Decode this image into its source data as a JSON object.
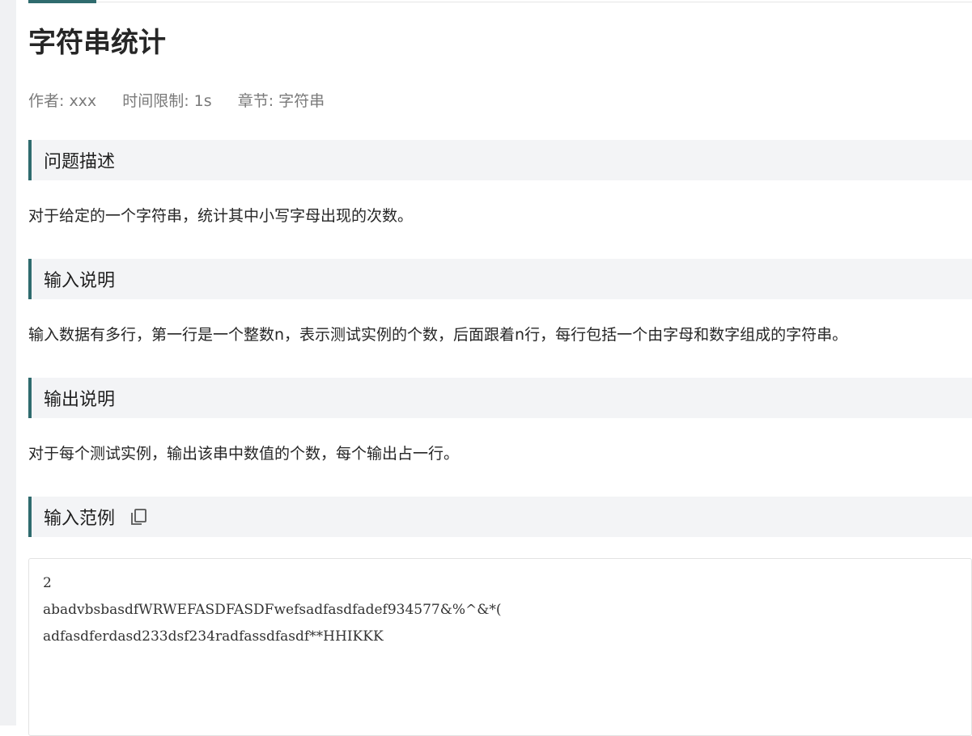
{
  "problem": {
    "title": "字符串统计",
    "meta": {
      "author": "作者: xxx",
      "time_limit": "时间限制: 1s",
      "chapter": "章节: 字符串"
    }
  },
  "sections": {
    "description": {
      "title": "问题描述",
      "text": "对于给定的一个字符串，统计其中小写字母出现的次数。"
    },
    "input": {
      "title": "输入说明",
      "text": "输入数据有多行，第一行是一个整数n，表示测试实例的个数，后面跟着n行，每行包括一个由字母和数字组成的字符串。"
    },
    "output": {
      "title": "输出说明",
      "text": "对于每个测试实例，输出该串中数值的个数，每个输出占一行。"
    },
    "sample_input": {
      "title": "输入范例",
      "copy_icon": "copy-icon",
      "lines": [
        "2",
        "abadvbsbasdfWRWEFASDFASDFwefsadfasdfadef934577&%^&*(",
        "adfasdferdasd233dsf234radfassdfasdf**HHIKKK"
      ]
    }
  },
  "colors": {
    "accent": "#2f6b6e",
    "section_bg": "#f3f4f6",
    "meta_text": "#7a7a7a"
  }
}
